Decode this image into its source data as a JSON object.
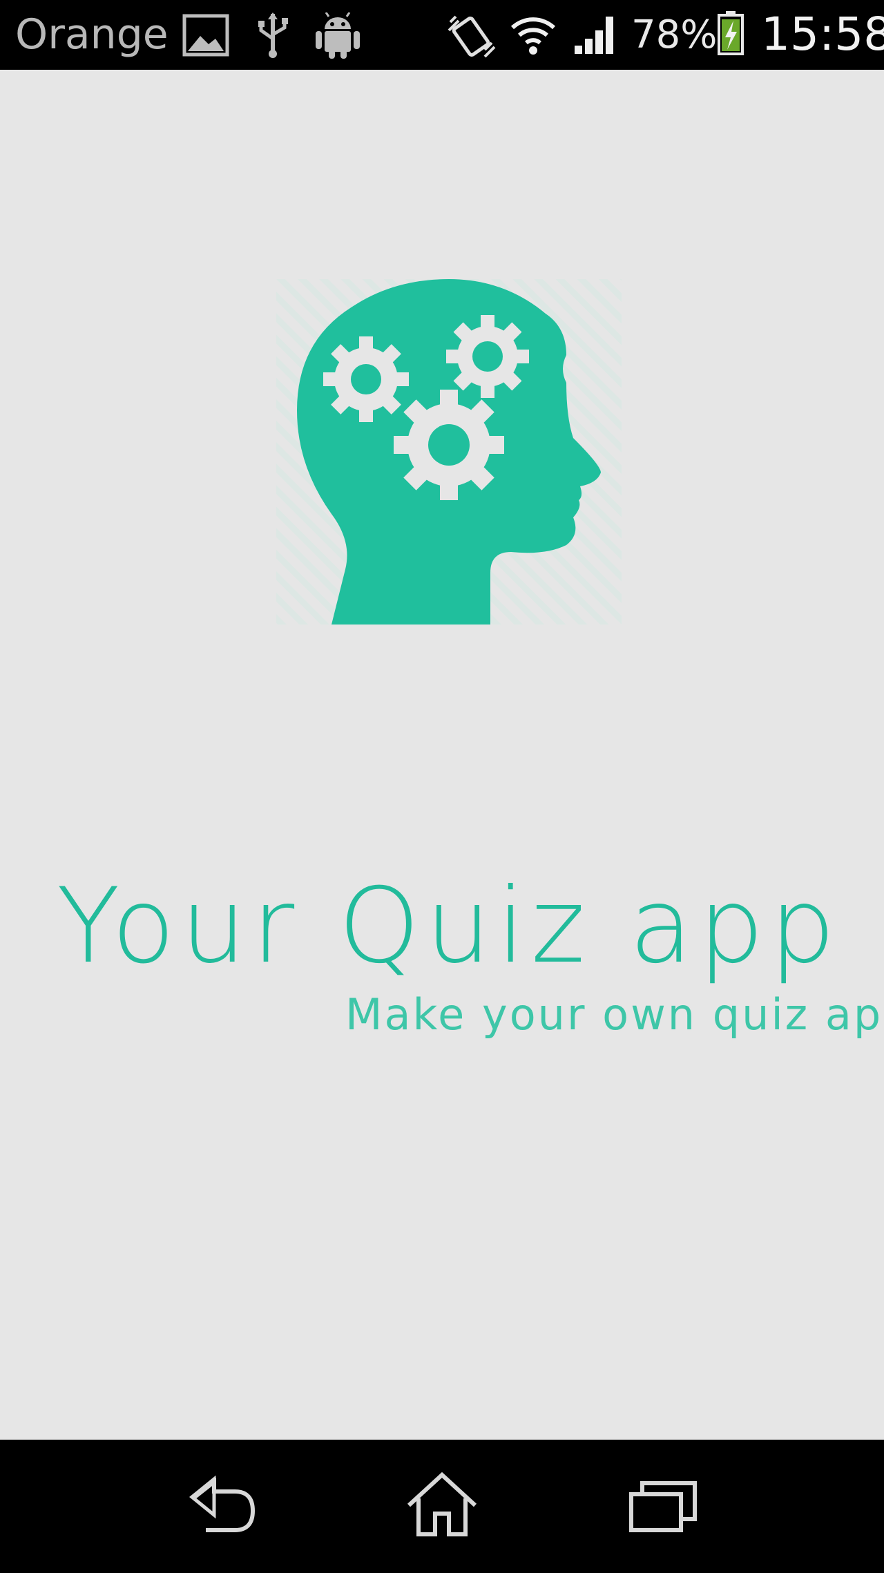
{
  "status_bar": {
    "carrier": "Orange",
    "battery_percent": "78%",
    "time": "15:58",
    "icons": [
      "image-icon",
      "usb-icon",
      "android-icon",
      "vibrate-icon",
      "wifi-icon",
      "signal-icon",
      "battery-charging-icon"
    ]
  },
  "splash": {
    "logo_icon": "head-gears-icon",
    "title": "Your Quiz app",
    "subtitle": "Make your own quiz app",
    "accent_color": "#22bb9b"
  },
  "nav_bar": {
    "buttons": [
      "back-button",
      "home-button",
      "recents-button"
    ]
  }
}
